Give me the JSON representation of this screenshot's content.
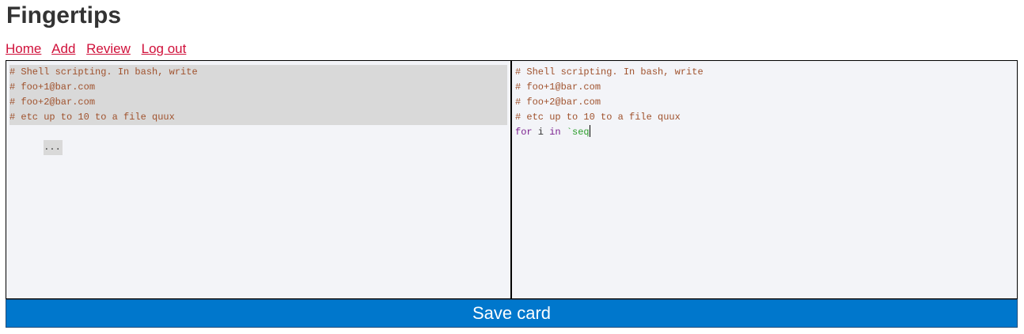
{
  "app": {
    "title": "Fingertips"
  },
  "nav": {
    "items": [
      {
        "label": "Home"
      },
      {
        "label": "Add"
      },
      {
        "label": "Review"
      },
      {
        "label": "Log out"
      }
    ]
  },
  "card": {
    "prompt_lines": [
      "# Shell scripting. In bash, write",
      "# foo+1@bar.com",
      "# foo+2@bar.com",
      "# etc up to 10 to a file quux"
    ],
    "prompt_placeholder": "...",
    "answer_lines": [
      "# Shell scripting. In bash, write",
      "# foo+1@bar.com",
      "# foo+2@bar.com",
      "# etc up to 10 to a file quux"
    ],
    "answer_code": {
      "keyword_for": "for",
      "var": " i ",
      "keyword_in": "in",
      "space": " ",
      "backtick_str": "`seq"
    }
  },
  "actions": {
    "save_label": "Save card"
  },
  "colors": {
    "comment": "#a0522d",
    "keyword": "#7a1f8f",
    "string": "#2a9d2a",
    "link": "#d0103a",
    "save_button": "#0077cc",
    "editor_bg": "#f3f4f8",
    "highlight": "#d9d9d9"
  }
}
